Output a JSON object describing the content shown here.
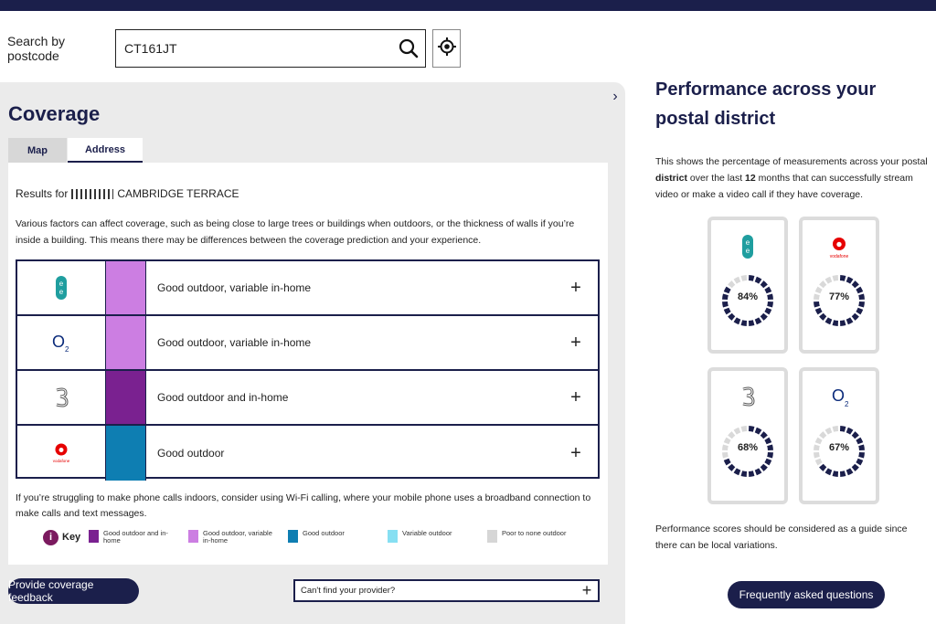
{
  "search": {
    "label": "Search by postcode",
    "value": "CT161JT"
  },
  "coverage": {
    "title": "Coverage",
    "tabs": [
      {
        "label": "Map",
        "active": false
      },
      {
        "label": "Address",
        "active": true
      }
    ],
    "results_prefix": "Results for",
    "results_address": "CAMBRIDGE TERRACE",
    "factors_text": "Various factors can affect coverage, such as being close to large trees or buildings when outdoors, or the thickness of walls if you’re inside a building. This means there may be differences between the coverage prediction and your experience.",
    "providers": [
      {
        "logo": "ee-logo-icon",
        "color": "#cc7ee2",
        "status": "Good outdoor, variable in-home"
      },
      {
        "logo": "o2-logo-icon",
        "color": "#cc7ee2",
        "status": "Good outdoor, variable in-home"
      },
      {
        "logo": "three-logo-icon",
        "color": "#7a2190",
        "status": "Good outdoor and in-home"
      },
      {
        "logo": "vodafone-logo-icon",
        "color": "#0e7eb2",
        "status": "Good outdoor"
      }
    ],
    "wifi_text": "If you’re struggling to make phone calls indoors, consider using Wi-Fi calling, where your mobile phone uses a broadband connection to make calls and text messages.",
    "key": {
      "label": "Key",
      "items": [
        {
          "color": "#7a2190",
          "label": "Good outdoor and in-home"
        },
        {
          "color": "#cc7ee2",
          "label": "Good outdoor, variable in-home"
        },
        {
          "color": "#0e7eb2",
          "label": "Good outdoor"
        },
        {
          "color": "#86dff2",
          "label": "Variable outdoor"
        },
        {
          "color": "#d6d6d6",
          "label": "Poor to none outdoor"
        }
      ]
    },
    "feedback_label": "Provide coverage feedback",
    "provider_dropdown": "Can't find your provider?"
  },
  "performance": {
    "title": "Performance across your postal district",
    "desc_parts": [
      "This shows the percentage of measurements across your postal ",
      "district",
      " over the last ",
      "12",
      " months that can successfully stream video or make a video call if they have coverage."
    ],
    "scores": [
      {
        "provider": "EE",
        "logo": "ee-logo-icon",
        "value": 84,
        "label": "84%"
      },
      {
        "provider": "Vodafone",
        "logo": "vodafone-logo-icon",
        "value": 77,
        "label": "77%"
      },
      {
        "provider": "Three",
        "logo": "three-logo-icon",
        "value": 68,
        "label": "68%"
      },
      {
        "provider": "O2",
        "logo": "o2-logo-icon",
        "value": 67,
        "label": "67%"
      }
    ],
    "note": "Performance scores should be considered as a guide since there can be local variations.",
    "faq_label": "Frequently asked questions"
  },
  "colors": {
    "navy": "#1b1f4b",
    "ee_teal": "#1f9e9f",
    "vodafone_red": "#e60000"
  }
}
